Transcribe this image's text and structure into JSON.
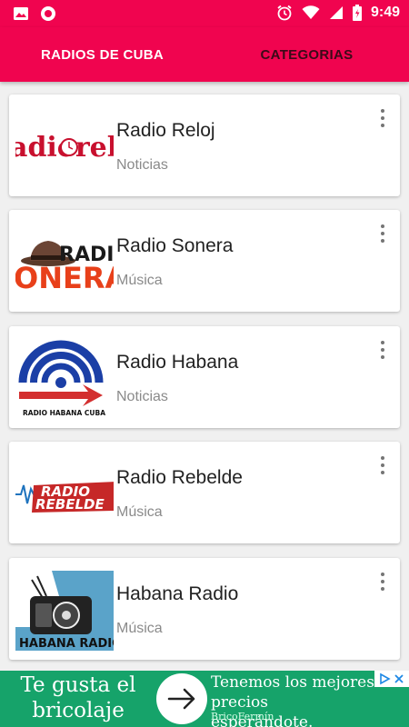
{
  "status_bar": {
    "time": "9:49",
    "icons": [
      "image-icon",
      "record-icon",
      "alarm-icon",
      "wifi-icon",
      "signal-icon",
      "battery-icon"
    ]
  },
  "tabs": [
    {
      "label": "RADIOS DE CUBA",
      "active": true
    },
    {
      "label": "CATEGORIAS",
      "active": false
    }
  ],
  "stations": [
    {
      "name": "Radio Reloj",
      "category": "Noticias",
      "logo_text": "adioreloj"
    },
    {
      "name": "Radio Sonera",
      "category": "Música",
      "logo_text_top": "RADIO",
      "logo_text_bottom": "ONERA"
    },
    {
      "name": "Radio Habana",
      "category": "Noticias",
      "logo_text": "RADIO HABANA CUBA"
    },
    {
      "name": "Radio Rebelde",
      "category": "Música",
      "logo_text_top": "RADIO",
      "logo_text_bottom": "REBELDE"
    },
    {
      "name": "Habana Radio",
      "category": "Música",
      "logo_text": "HABANA RADIO"
    }
  ],
  "ad": {
    "left_text": "Te gusta el bricolaje",
    "right_text": "Tenemos los mejores precios esperándote.",
    "sponsor": "BricoFermín",
    "icons": [
      "arrow-right-icon",
      "adchoices-icon",
      "close-icon"
    ]
  },
  "colors": {
    "primary": "#f0044f",
    "inactive_tab_text": "#3b0a18",
    "ad_background": "#16a36a",
    "category_text": "#8a8a8a"
  }
}
